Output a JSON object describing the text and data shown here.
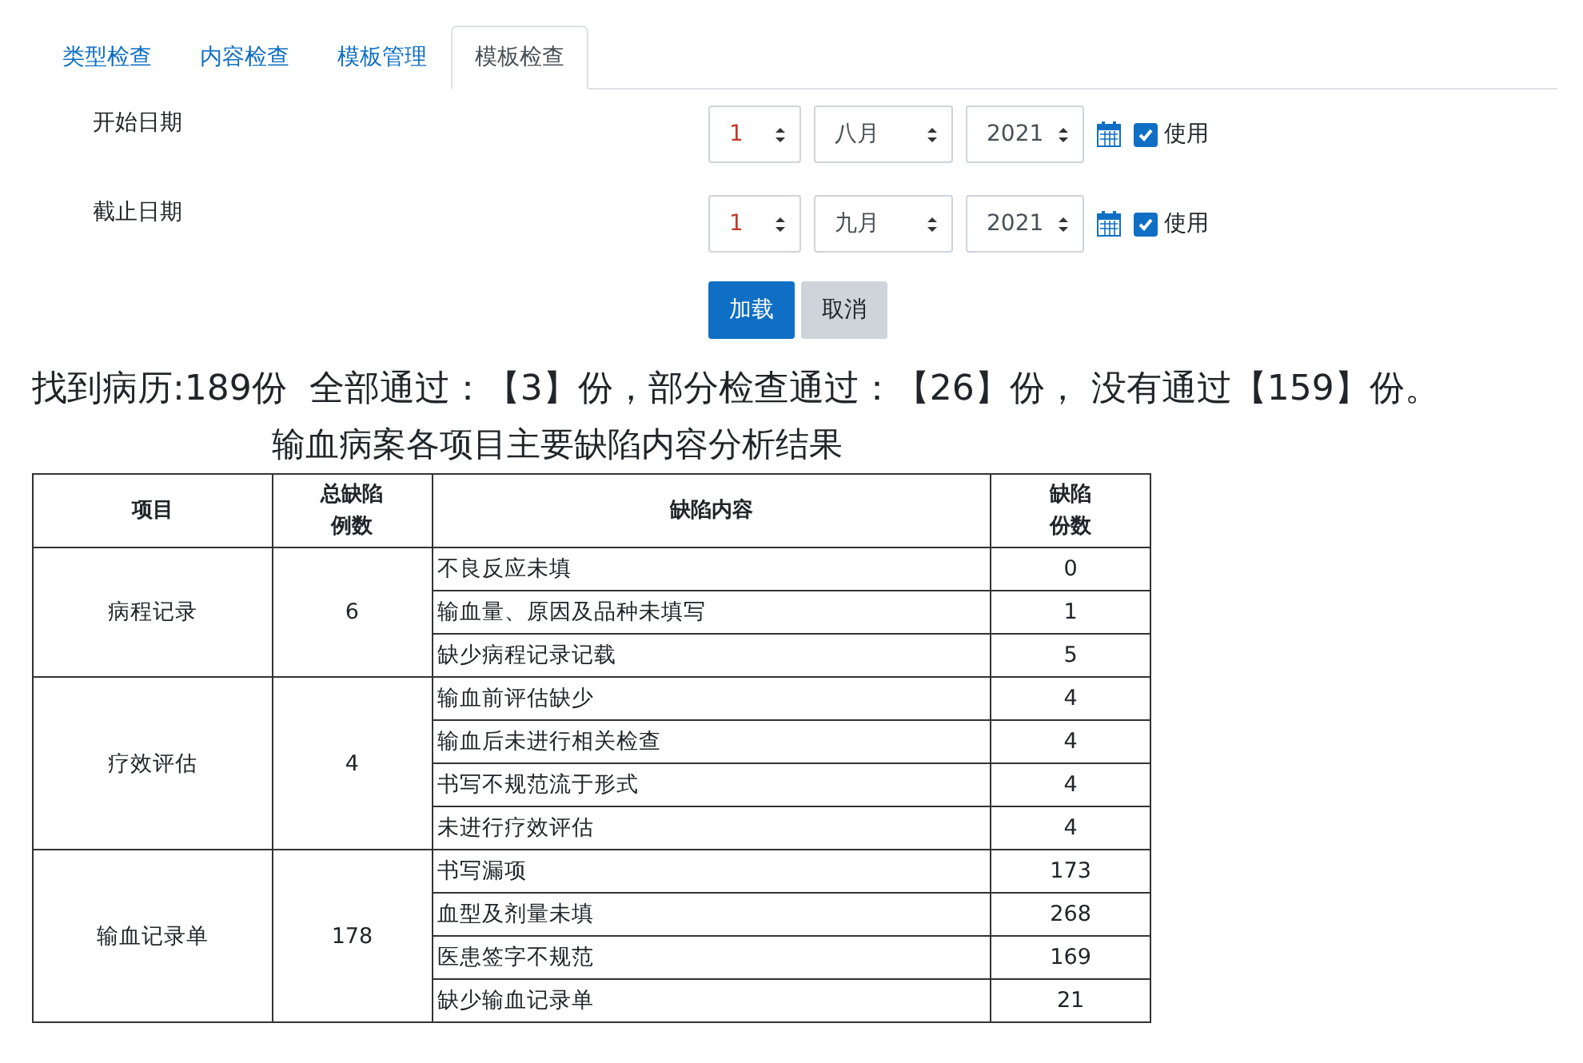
{
  "tabs": [
    {
      "label": "类型检查",
      "selected": false
    },
    {
      "label": "内容检查",
      "selected": false
    },
    {
      "label": "模板管理",
      "selected": false
    },
    {
      "label": "模板检查",
      "selected": true
    }
  ],
  "date_rows": [
    {
      "label": "开始日期",
      "day": "1",
      "month": "八月",
      "year": "2021",
      "use_label": "使用",
      "checked": true
    },
    {
      "label": "截止日期",
      "day": "1",
      "month": "九月",
      "year": "2021",
      "use_label": "使用",
      "checked": true
    }
  ],
  "buttons": [
    {
      "label": "加载",
      "kind": "primary"
    },
    {
      "label": "取消",
      "kind": "secondary"
    }
  ],
  "summary": "找到病历:189份  全部通过：【3】份，部分检查通过：【26】份， 没有通过【159】份。",
  "table_title": "输血病案各项目主要缺陷内容分析结果",
  "columns": [
    "项目",
    "总缺陷例数",
    "缺陷内容",
    "缺陷份数"
  ],
  "groups": [
    {
      "item": "病程记录",
      "total": "6",
      "defects": [
        {
          "content": "不良反应未填",
          "count": "0"
        },
        {
          "content": "输血量、原因及品种未填写",
          "count": "1"
        },
        {
          "content": "缺少病程记录记载",
          "count": "5"
        }
      ]
    },
    {
      "item": "疗效评估",
      "total": "4",
      "defects": [
        {
          "content": "输血前评估缺少",
          "count": "4"
        },
        {
          "content": "输血后未进行相关检查",
          "count": "4"
        },
        {
          "content": "书写不规范流于形式",
          "count": "4"
        },
        {
          "content": "未进行疗效评估",
          "count": "4"
        }
      ]
    },
    {
      "item": "输血记录单",
      "total": "178",
      "defects": [
        {
          "content": "书写漏项",
          "count": "173"
        },
        {
          "content": "血型及剂量未填",
          "count": "268"
        },
        {
          "content": "医患签字不规范",
          "count": "169"
        },
        {
          "content": "缺少输血记录单",
          "count": "21"
        }
      ]
    }
  ]
}
